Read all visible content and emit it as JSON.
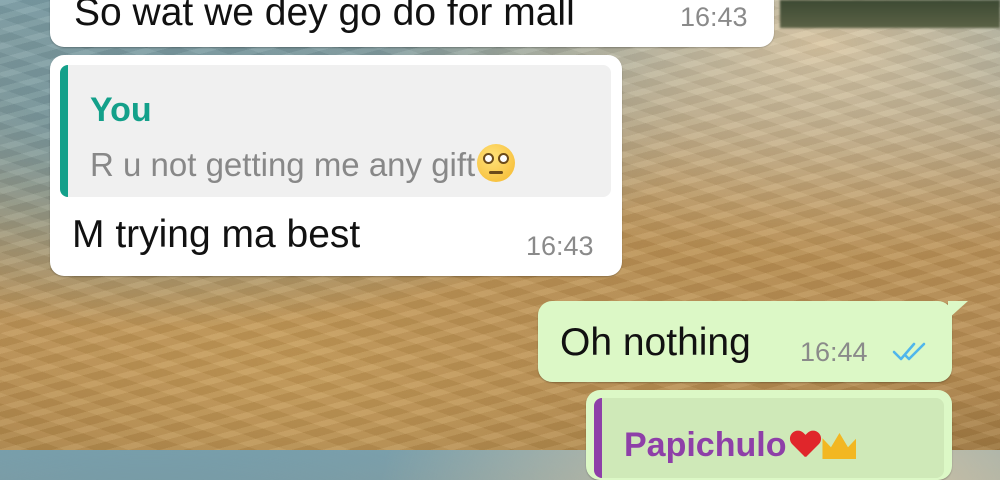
{
  "messages": [
    {
      "direction": "incoming",
      "text": "So wat we dey go do for mall",
      "time": "16:43"
    },
    {
      "direction": "incoming",
      "quote": {
        "author": "You",
        "text": "R u not getting me any gift",
        "emoji": "face-with-rolling-eyes"
      },
      "text": "M trying ma best",
      "time": "16:43"
    },
    {
      "direction": "outgoing",
      "text": "Oh nothing",
      "time": "16:44",
      "status": "read",
      "status_icon": "double-check-icon"
    },
    {
      "direction": "outgoing",
      "quote": {
        "author": "Papichulo",
        "emojis": [
          "heart",
          "crown"
        ]
      }
    }
  ],
  "colors": {
    "incoming_bubble": "#ffffff",
    "outgoing_bubble": "#dcf8c6",
    "quote_you": "#13a08a",
    "quote_papichulo": "#8e3fa8",
    "read_ticks": "#4fb6ec"
  }
}
